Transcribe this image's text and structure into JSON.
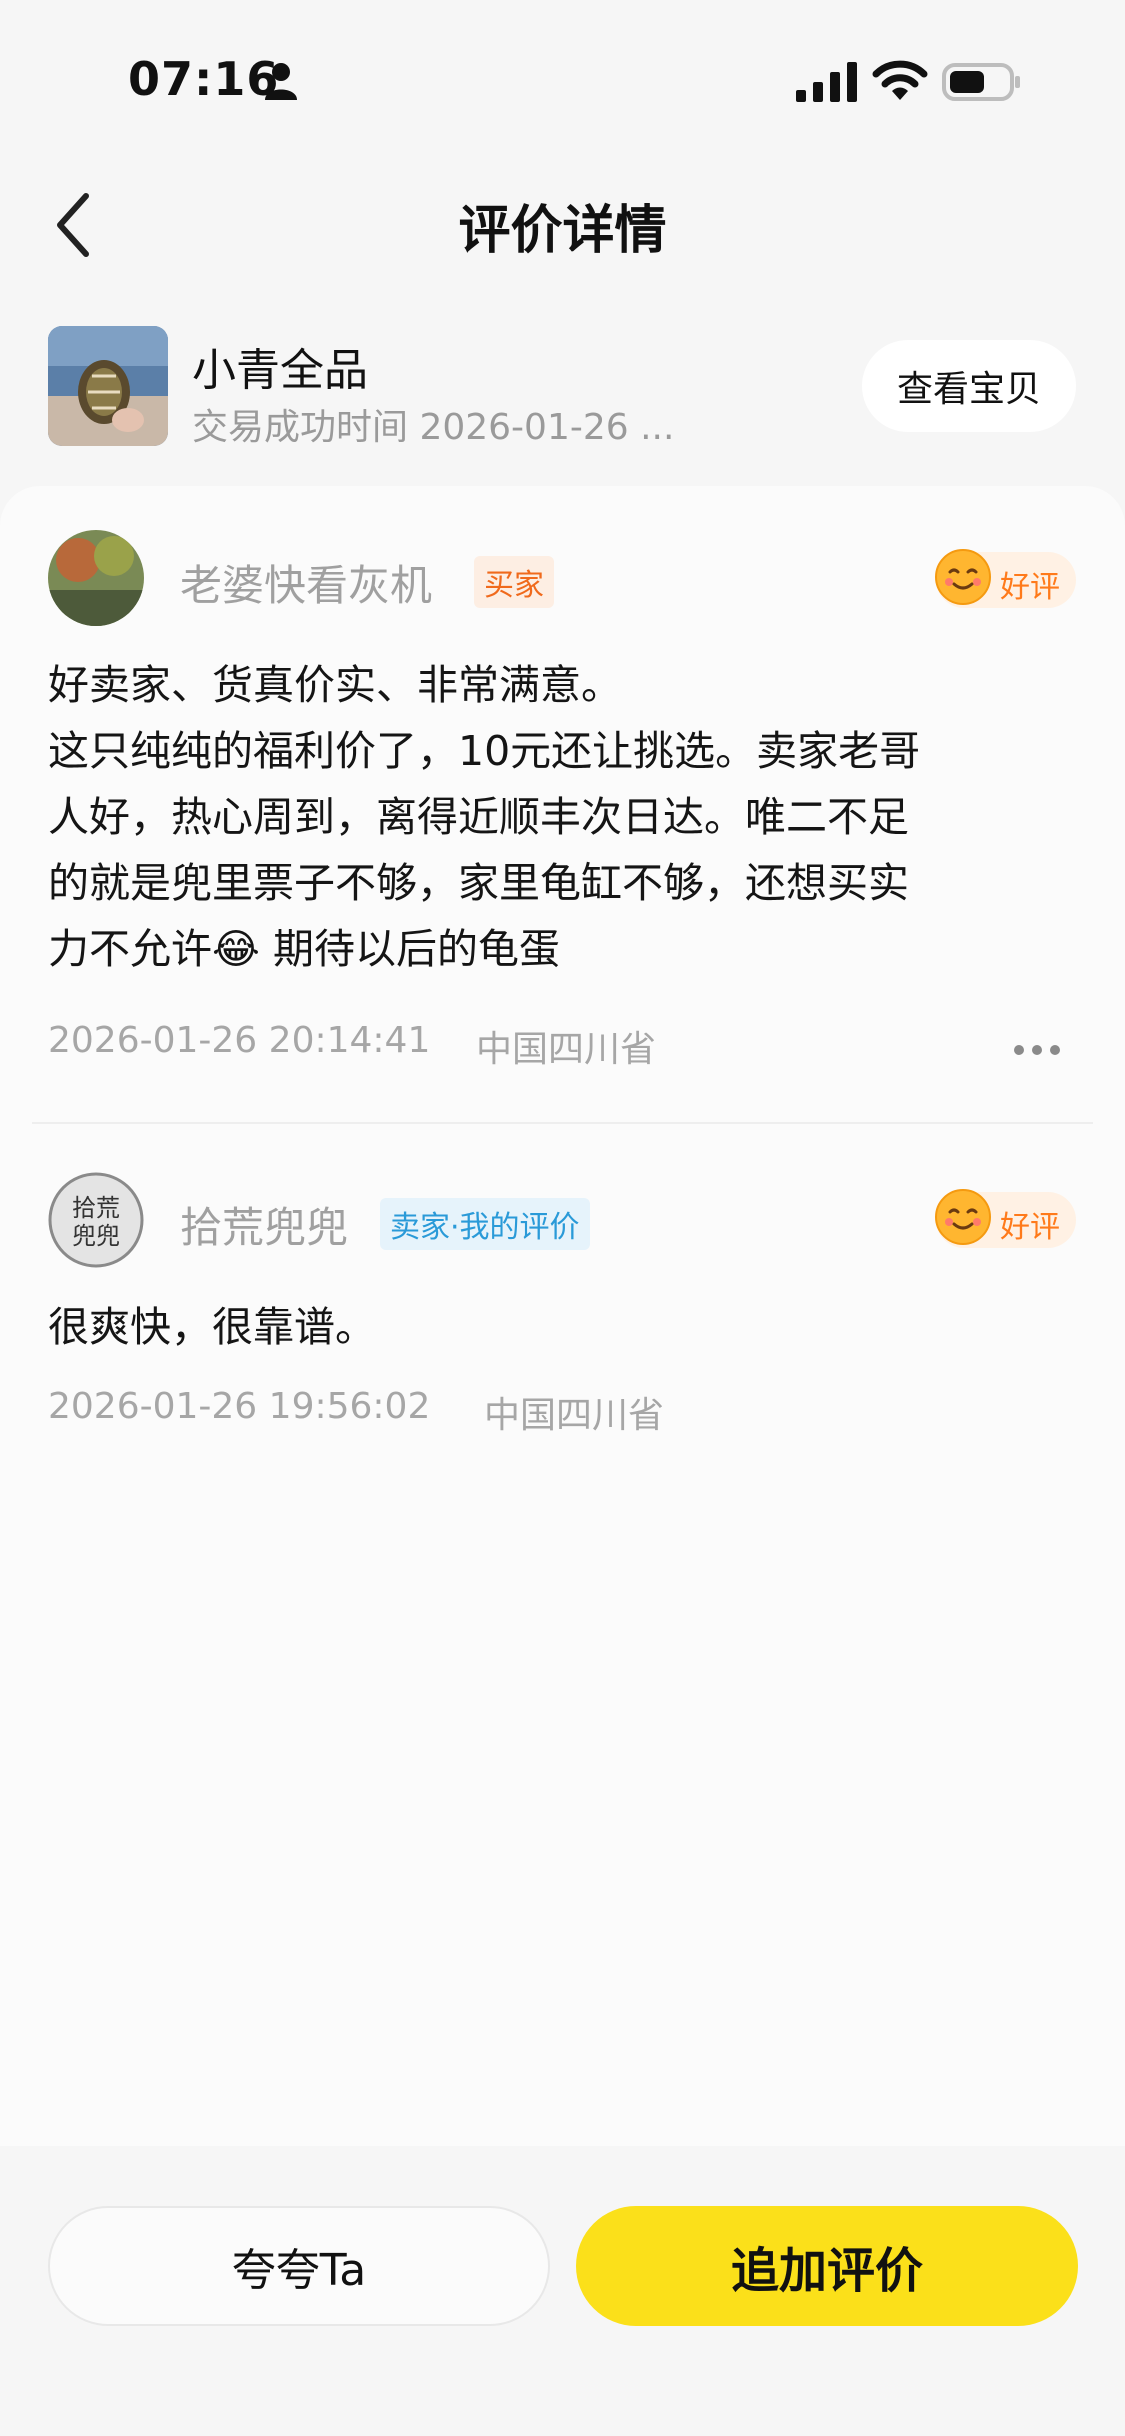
{
  "status_bar": {
    "time": "07:16"
  },
  "header": {
    "title": "评价详情"
  },
  "product": {
    "name": "小青全品",
    "subtitle": "交易成功时间 2026-01-26 ...",
    "view_button": "查看宝贝"
  },
  "reviews": [
    {
      "user_name": "老婆快看灰机",
      "role": "买家",
      "rating": "好评",
      "text_lines": [
        "好卖家、货真价实、非常满意。",
        "这只纯纯的福利价了，10元还让挑选。卖家老哥",
        "人好，热心周到，离得近顺丰次日达。唯二不足",
        "的就是兜里票子不够，家里龟缸不够，还想买实",
        "力不允许😂 期待以后的龟蛋"
      ],
      "time": "2026-01-26 20:14:41",
      "location": "中国四川省"
    },
    {
      "user_name": "拾荒兜兜",
      "avatar_text": "拾荒兜兜",
      "role": "卖家·我的评价",
      "rating": "好评",
      "text": "很爽快，很靠谱。",
      "time": "2026-01-26 19:56:02",
      "location": "中国四川省"
    }
  ],
  "bottom_bar": {
    "praise_label": "夸夸Ta",
    "add_review_label": "追加评价"
  },
  "colors": {
    "accent_yellow": "#fbe01a",
    "buyer_badge": "#f06a1c",
    "seller_badge": "#2a9ad8",
    "rating_orange": "#ff7a1a"
  },
  "icons": [
    "person-icon",
    "signal-icon",
    "wifi-icon",
    "battery-icon",
    "back-icon",
    "smile-icon",
    "more-icon"
  ]
}
